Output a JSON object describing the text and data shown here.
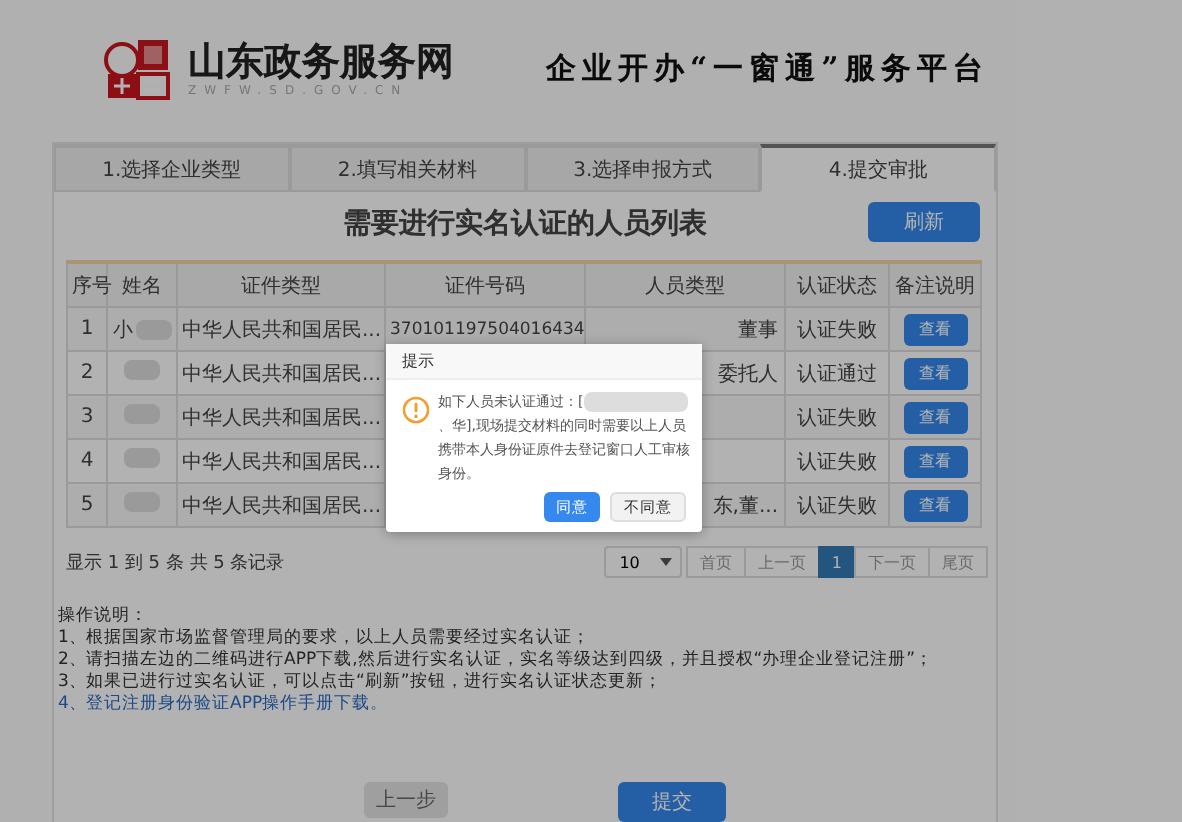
{
  "header": {
    "site_name": "山东政务服务网",
    "site_domain": "ZWFW.SD.GOV.CN",
    "platform_title": "企业开办“一窗通”服务平台"
  },
  "steps": [
    {
      "label": "1.选择企业类型",
      "selected": false
    },
    {
      "label": "2.填写相关材料",
      "selected": false
    },
    {
      "label": "3.选择申报方式",
      "selected": false
    },
    {
      "label": "4.提交审批",
      "selected": true
    }
  ],
  "list_title": "需要进行实名认证的人员列表",
  "refresh_button": "刷新",
  "table": {
    "columns": [
      "序号",
      "姓名",
      "证件类型",
      "证件号码",
      "人员类型",
      "认证状态",
      "备注说明"
    ],
    "rows": [
      {
        "index": "1",
        "name": "小",
        "id_type": "中华人民共和国居民...",
        "id_number": "370101197504016434",
        "person_type": "董事",
        "status": "认证失败",
        "action": "查看"
      },
      {
        "index": "2",
        "id_type": "中华人民共和国居民...",
        "person_type": "委托人",
        "status": "认证通过",
        "action": "查看"
      },
      {
        "index": "3",
        "id_type": "中华人民共和国居民...",
        "status": "认证失败",
        "action": "查看"
      },
      {
        "index": "4",
        "id_type": "中华人民共和国居民...",
        "status": "认证失败",
        "action": "查看"
      },
      {
        "index": "5",
        "id_type": "中华人民共和国居民...",
        "person_type": "东,董...",
        "status": "认证失败",
        "action": "查看"
      }
    ]
  },
  "record_info": "显示 1 到 5 条 共 5 条记录",
  "pagination": {
    "page_size": "10",
    "buttons": [
      {
        "label": "首页",
        "selected": false
      },
      {
        "label": "上一页",
        "selected": false
      },
      {
        "label": "1",
        "selected": true
      },
      {
        "label": "下一页",
        "selected": false
      },
      {
        "label": "尾页",
        "selected": false
      }
    ]
  },
  "instructions": {
    "title": "操作说明：",
    "items": [
      {
        "number": "1、",
        "text": "根据国家市场监督管理局的要求，以上人员需要经过实名认证；",
        "kind": "text"
      },
      {
        "number": "2、",
        "text": "请扫描左边的二维码进行APP下载,然后进行实名认证，实名等级达到四级，并且授权“办理企业登记注册”；",
        "kind": "text"
      },
      {
        "number": "3、",
        "text": "如果已进行过实名认证，可以点击“刷新”按钮，进行实名认证状态更新；",
        "kind": "text"
      },
      {
        "number": "4、",
        "text": "登记注册身份验证APP操作手册下载。",
        "kind": "link"
      }
    ]
  },
  "prev_button": "上一步",
  "submit_button": "提交",
  "dialog": {
    "title": "提示",
    "message_start": "如下人员未认证通过：[",
    "message_mid": "、",
    "message_end": "华],现场提交材料的同时需要以上人员携带本人身份证原件去登记窗口人工审核身份。",
    "agree_button": "同意",
    "disagree_button": "不同意"
  }
}
